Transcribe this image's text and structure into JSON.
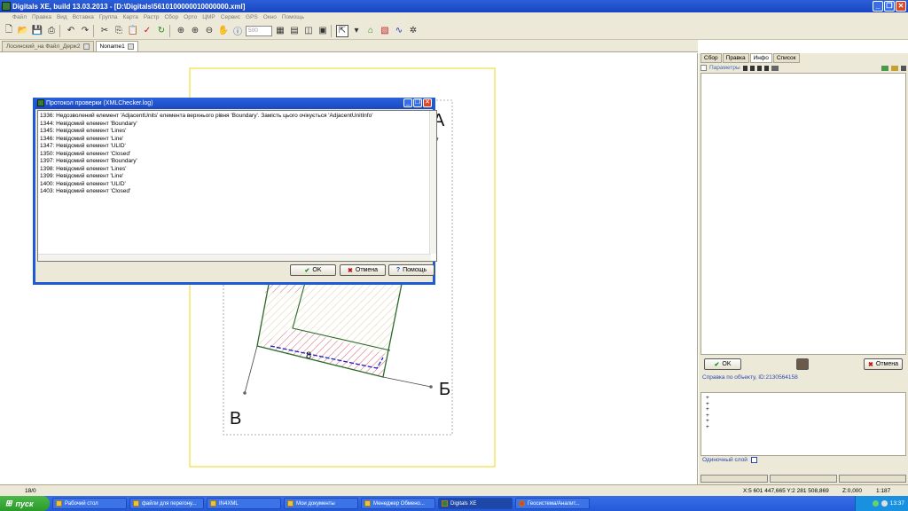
{
  "window": {
    "title": "Digitals XE, build 13.03.2013 - [D:\\Digitals\\5610100000010000000.xml]",
    "controls": [
      "_",
      "❐",
      "✕"
    ]
  },
  "menu": [
    "Файл",
    "Правка",
    "Вид",
    "Вставка",
    "Группа",
    "Карта",
    "Растр",
    "Сбор",
    "Орто",
    "ЦМР",
    "Сервис",
    "GPS",
    "Окно",
    "Помощь"
  ],
  "toolbar": {
    "scale_value": "500"
  },
  "doc_tabs": [
    {
      "label": "Лосинский_на Файл_Держ2"
    },
    {
      "label": "Noname1"
    }
  ],
  "map": {
    "point_labels": {
      "a": "А",
      "b": "Б",
      "v": "В",
      "dim": "8"
    }
  },
  "dialog": {
    "title": "Протокол проверки (XMLChecker.log)",
    "lines": [
      "1336: Недозволений елемент 'AdjacentUnits' елемента верхнього рівня 'Boundary'. Замість цього очікується 'AdjacentUnitInfo'",
      "1344: Невідомий елемент 'Boundary'",
      "1345: Невідомий елемент 'Lines'",
      "1346: Невідомий елемент 'Line'",
      "1347: Невідомий елемент 'ULID'",
      "1350: Невідомий елемент 'Closed'",
      "1397: Невідомий елемент 'Boundary'",
      "1398: Невідомий елемент 'Lines'",
      "1399: Невідомий елемент 'Line'",
      "1400: Невідомий елемент 'ULID'",
      "1403: Невідомий елемент 'Closed'"
    ],
    "ok_label": "OK",
    "cancel_label": "Отмена",
    "help_label": "Помощь"
  },
  "right_panel": {
    "tabs": [
      "Сбор",
      "Правка",
      "Инфо",
      "Список"
    ],
    "active_tab": "Инфо",
    "params_label": "Параметры",
    "ok_label": "OK",
    "cancel_label": "Отмена",
    "info_header": "Справка по объекту, ID:2130564158",
    "info_lines": [
      "+",
      "+",
      "+",
      "+",
      "+",
      "+"
    ],
    "single_layer_label": "Одиночный слой"
  },
  "status": {
    "left": "18/0",
    "coords": "X:5 601 447,665   Y:2 281 508,869",
    "zoom": "Z:0,000",
    "scale": "1:187"
  },
  "taskbar": {
    "start_label": "пуск",
    "items": [
      {
        "label": "Рабочий стол"
      },
      {
        "label": "файли для перегону..."
      },
      {
        "label": "IN4XML"
      },
      {
        "label": "Мои документы"
      },
      {
        "label": "Менеджер Обмено..."
      },
      {
        "label": "Digitals XE"
      },
      {
        "label": "Геосистема/Аналит..."
      }
    ],
    "clock": "13:37"
  },
  "colors": {
    "xp_blue": "#1c5ad8",
    "panel_bg": "#ece9d8",
    "boundary_green": "#2a6a2a",
    "hatch_pink": "#e07090",
    "accent_blue": "#2020c0"
  }
}
